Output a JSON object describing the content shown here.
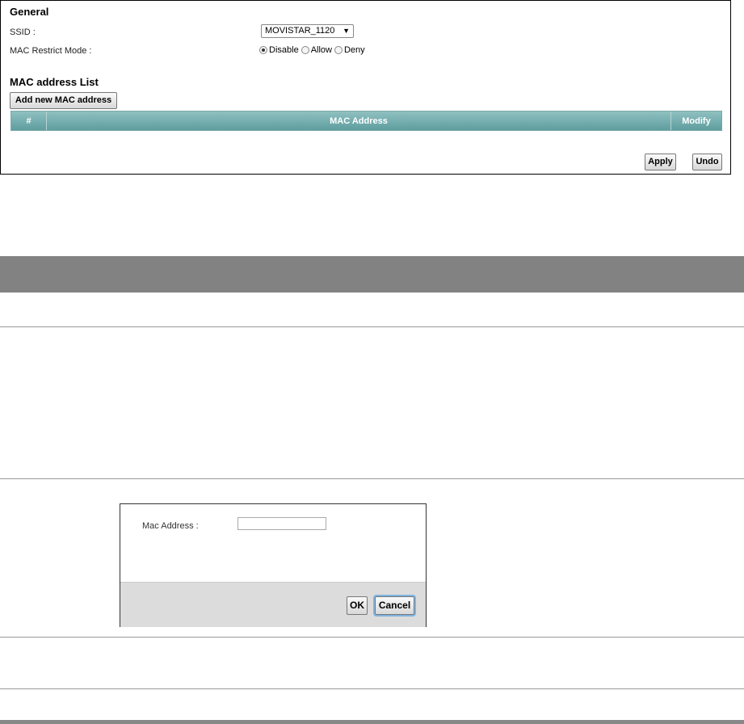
{
  "general": {
    "title": "General",
    "ssid_label": "SSID :",
    "ssid_value": "MOVISTAR_1120",
    "mac_mode_label": "MAC Restrict Mode :",
    "mac_mode_options": [
      "Disable",
      "Allow",
      "Deny"
    ],
    "mac_mode_selected": "Disable"
  },
  "mac_list": {
    "title": "MAC address List",
    "add_button": "Add new MAC address",
    "columns": [
      "#",
      "MAC Address",
      "Modify"
    ],
    "rows": []
  },
  "actions": {
    "apply": "Apply",
    "undo": "Undo"
  },
  "dialog": {
    "label": "Mac Address :",
    "input_value": "",
    "ok": "OK",
    "cancel": "Cancel"
  },
  "colors": {
    "table_header": "#5f9e9f",
    "doc_header": "#828282",
    "dialog_footer": "#dcdcdc"
  }
}
